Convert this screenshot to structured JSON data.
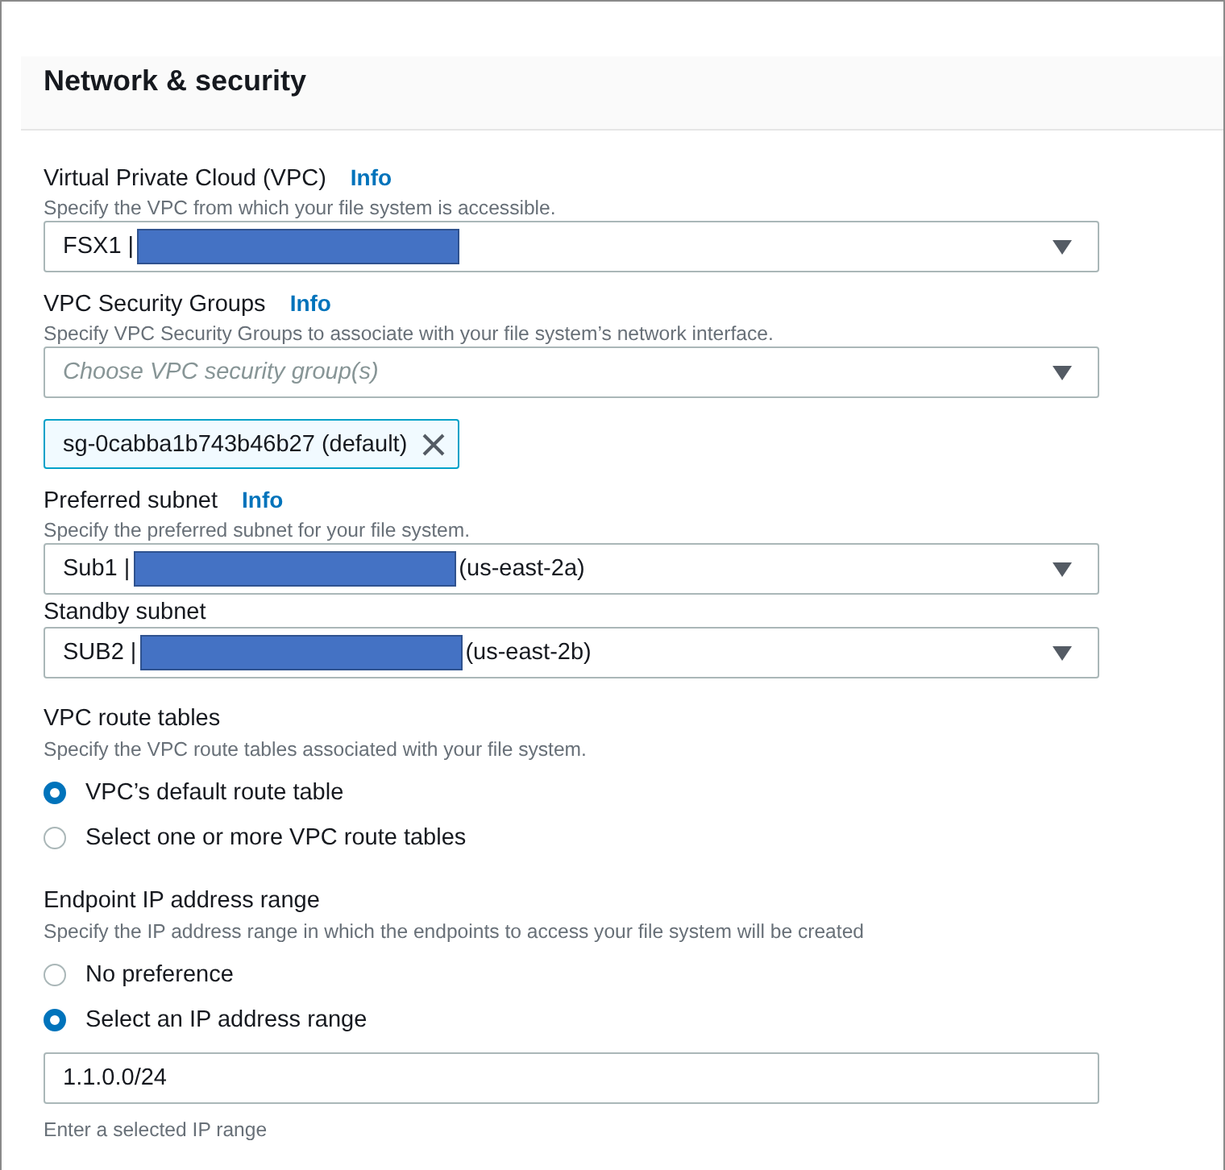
{
  "section": {
    "title": "Network & security"
  },
  "fields": [
    {
      "kind": "select",
      "label": "Virtual Private Cloud (VPC)",
      "info": "Info",
      "description": "Specify the VPC from which your file system is accessible.",
      "value": "FSX1 |",
      "redacted": true
    },
    {
      "kind": "multiselect",
      "label": "VPC Security Groups",
      "info": "Info",
      "description": "Specify VPC Security Groups to associate with your file system’s network interface.",
      "placeholder": "Choose VPC security group(s)",
      "tokens": [
        {
          "label": "sg-0cabba1b743b46b27 (default)"
        }
      ]
    },
    {
      "kind": "select",
      "label": "Preferred subnet",
      "info": "Info",
      "description": "Specify the preferred subnet for your file system.",
      "value": "Sub1 |",
      "redacted": true,
      "value_suffix": "(us-east-2a)"
    },
    {
      "kind": "select",
      "label": "Standby subnet",
      "value": "SUB2 |",
      "redacted": true,
      "value_suffix": "(us-east-2b)"
    },
    {
      "kind": "radio",
      "label": "VPC route tables",
      "description": "Specify the VPC route tables associated with your file system.",
      "options": [
        {
          "label": "VPC’s default route table",
          "selected": true
        },
        {
          "label": "Select one or more VPC route tables",
          "selected": false
        }
      ]
    },
    {
      "kind": "radio",
      "label": "Endpoint IP address range",
      "description": "Specify the IP address range in which the endpoints to access your file system will be created",
      "options": [
        {
          "label": "No preference",
          "selected": false
        },
        {
          "label": "Select an IP address range",
          "selected": true
        }
      ]
    },
    {
      "kind": "text",
      "value": "1.1.0.0/24",
      "hint": "Enter a selected IP range"
    }
  ]
}
